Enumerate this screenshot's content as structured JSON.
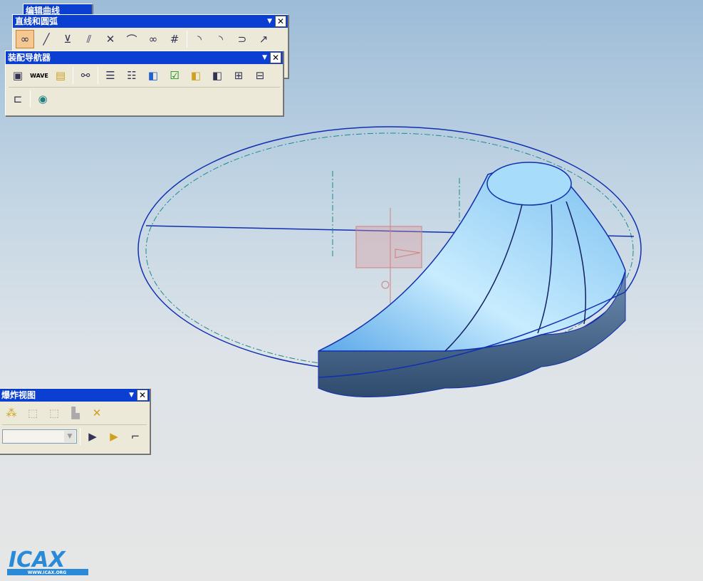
{
  "toolbars": {
    "edit_curve": {
      "title": "编辑曲线"
    },
    "line_arc": {
      "title": "直线和圆弧",
      "icons": [
        "association-icon",
        "line-icon",
        "line-point-xyz-icon",
        "line-parallel-icon",
        "line-perpendicular-icon",
        "line-tangent-icon",
        "line-tangent-tangent-icon",
        "infinite-line-icon",
        "arc-3pt-icon",
        "arc-center-icon",
        "arc-tangent-icon",
        "arc-end-icon"
      ]
    },
    "assembly_navigator": {
      "title": "装配导航器",
      "wave_label": "WAVE"
    },
    "exploded_view": {
      "title": "爆炸视图",
      "combo_value": ""
    }
  },
  "logo": {
    "text": "ICAX",
    "url": "WWW.ICAX.ORG"
  },
  "colors": {
    "titlebar": "#0a3fd1",
    "part": "#8fc8f0",
    "edge": "#1030b0"
  }
}
